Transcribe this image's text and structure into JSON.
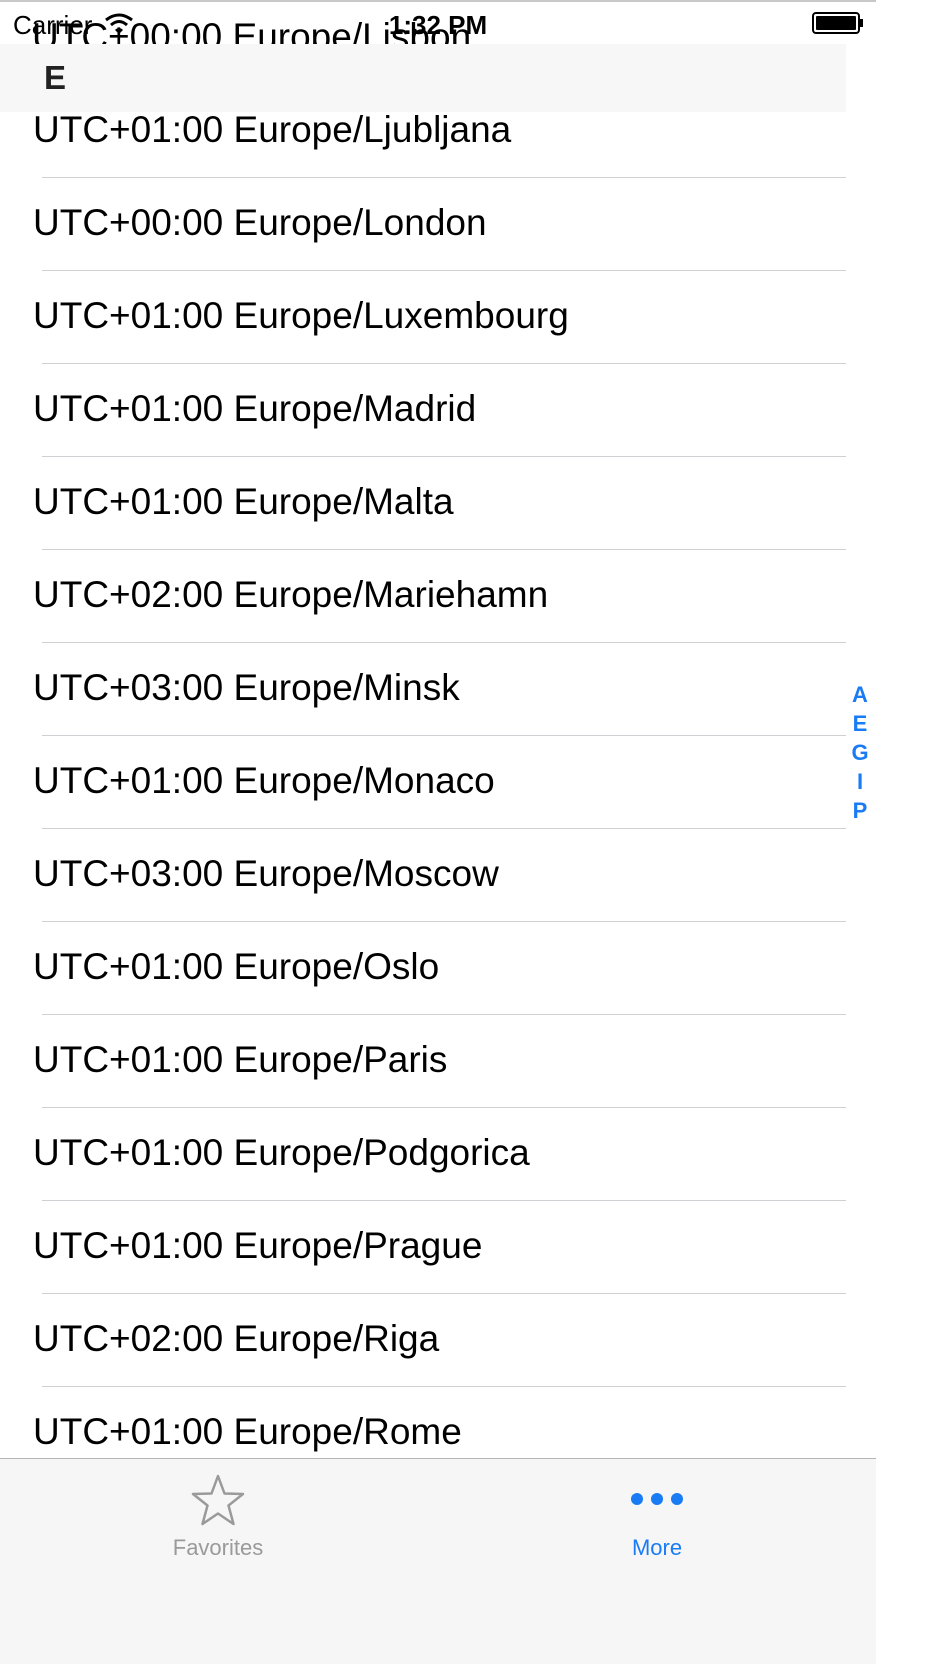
{
  "status_bar": {
    "carrier": "Carrier",
    "time": "1:32 PM"
  },
  "partial_row": "UTC+00:00 Europe/Lisbon",
  "section": {
    "title": "E"
  },
  "rows": [
    "UTC+01:00 Europe/Ljubljana",
    "UTC+00:00 Europe/London",
    "UTC+01:00 Europe/Luxembourg",
    "UTC+01:00 Europe/Madrid",
    "UTC+01:00 Europe/Malta",
    "UTC+02:00 Europe/Mariehamn",
    "UTC+03:00 Europe/Minsk",
    "UTC+01:00 Europe/Monaco",
    "UTC+03:00 Europe/Moscow",
    "UTC+01:00 Europe/Oslo",
    "UTC+01:00 Europe/Paris",
    "UTC+01:00 Europe/Podgorica",
    "UTC+01:00 Europe/Prague",
    "UTC+02:00 Europe/Riga",
    "UTC+01:00 Europe/Rome"
  ],
  "index_letters": [
    "A",
    "E",
    "G",
    "I",
    "P"
  ],
  "tab_bar": {
    "favorites_label": "Favorites",
    "favorites_icon": "star-outline-icon",
    "more_label": "More",
    "more_icon": "more-dots-icon",
    "selected": "More"
  },
  "colors": {
    "accent": "#1a7cf5",
    "inactive": "#9a9a9a",
    "section_bg": "#f7f7f7",
    "separator": "#d0d0d4"
  }
}
